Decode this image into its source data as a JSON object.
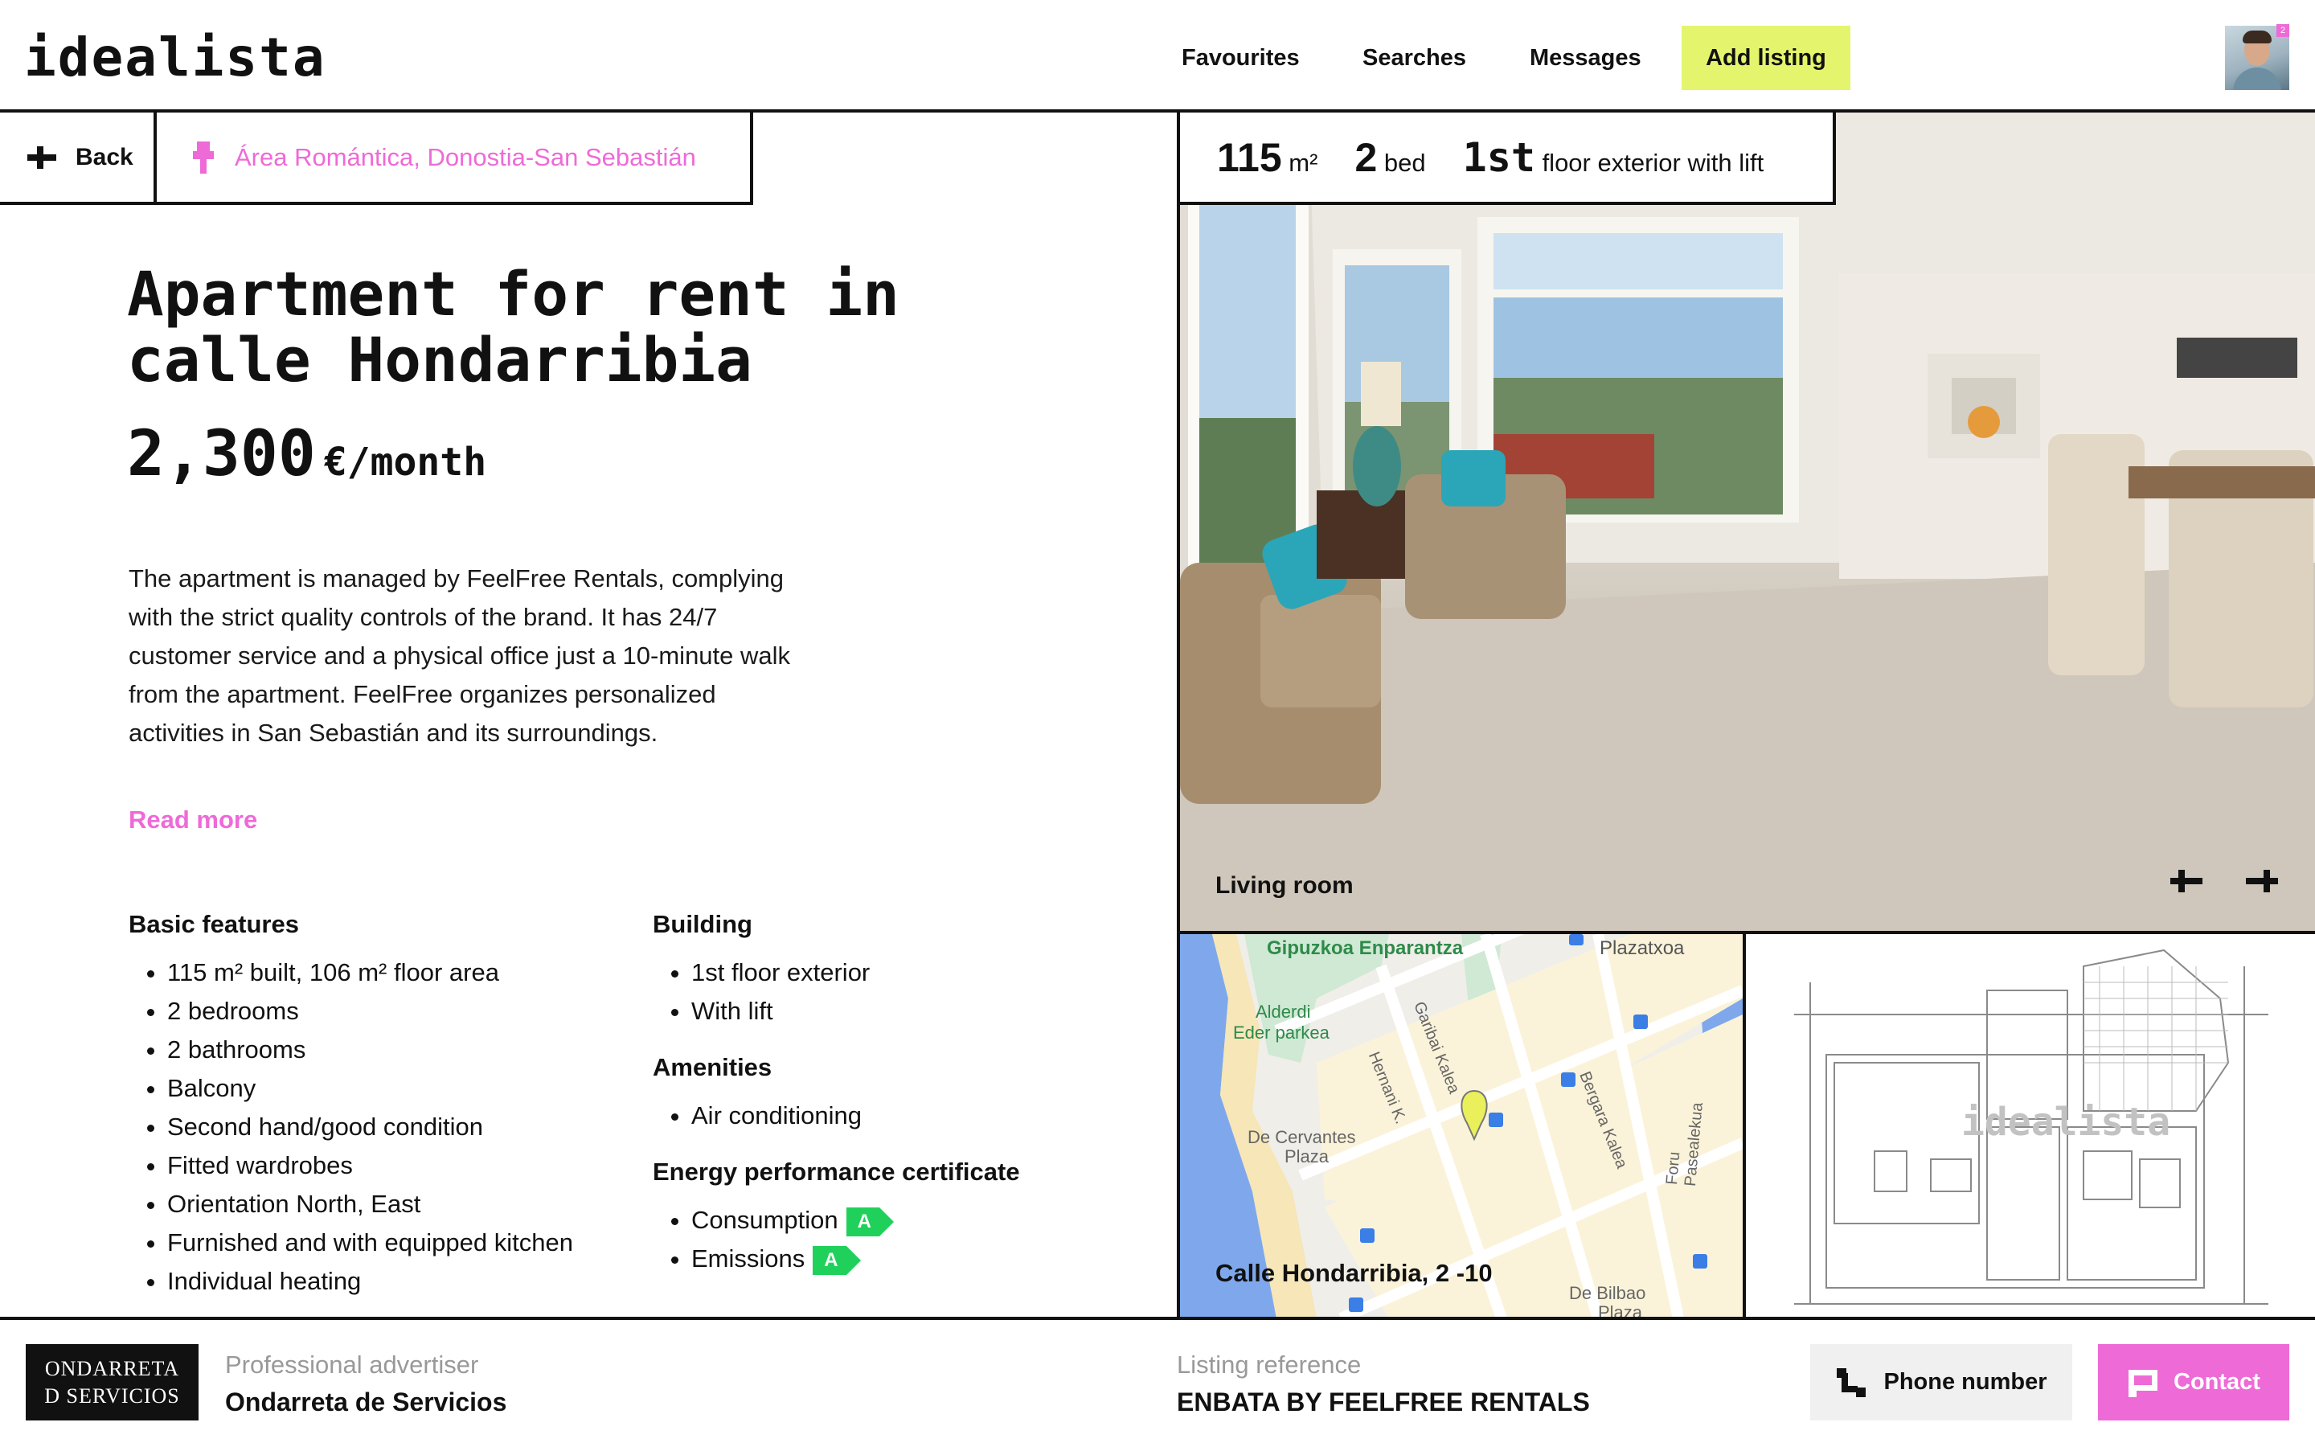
{
  "header": {
    "logo": "idealista",
    "nav": [
      "Favourites",
      "Searches",
      "Messages"
    ],
    "add_listing": "Add listing",
    "notification_count": "2"
  },
  "breadcrumb": {
    "back": "Back",
    "location": "Área Romántica, Donostia-San Sebastián"
  },
  "listing": {
    "title": "Apartment for rent in calle Hondarribia",
    "price": "2,300",
    "price_unit": "€/month",
    "description": "The apartment is managed by FeelFree Rentals, complying with the strict quality controls of the brand. It has 24/7 customer service and a physical office just a 10-minute walk from the apartment. FeelFree organizes personalized activities in San Sebastián and its surroundings.",
    "read_more": "Read more"
  },
  "stats": {
    "area_value": "115",
    "area_unit": "m²",
    "beds_value": "2",
    "beds_unit": "bed",
    "floor_value": "1st",
    "floor_text": "floor exterior with lift"
  },
  "features": {
    "basic_title": "Basic features",
    "basic": [
      "115 m² built, 106 m² floor area",
      "2 bedrooms",
      "2 bathrooms",
      "Balcony",
      "Second hand/good condition",
      "Fitted wardrobes",
      "Orientation North, East",
      "Furnished and with equipped kitchen",
      "Individual heating"
    ],
    "building_title": "Building",
    "building": [
      "1st floor exterior",
      "With lift"
    ],
    "amenities_title": "Amenities",
    "amenities": [
      "Air conditioning"
    ],
    "energy_title": "Energy performance certificate",
    "energy": [
      {
        "label": "Consumption",
        "rating": "A"
      },
      {
        "label": "Emissions",
        "rating": "A"
      }
    ]
  },
  "gallery": {
    "caption": "Living room"
  },
  "map": {
    "caption": "Calle Hondarribia, 2 -10",
    "labels": [
      "Gipuzkoa Enparantza",
      "Plazatxoa",
      "Alderdi",
      "Eder parkea",
      "Garibai Kalea",
      "Hernani K.",
      "Bergara Kalea",
      "Foru Pasealekua",
      "De Cervantes",
      "Plaza",
      "De Bilbao",
      "Plaza"
    ]
  },
  "floorplan": {
    "watermark": "idealista"
  },
  "footer": {
    "advertiser_logo_line1": "ONDARRETA",
    "advertiser_logo_line2": "D SERVICIOS",
    "advertiser_role": "Professional advertiser",
    "advertiser_name": "Ondarreta de Servicios",
    "reference_label": "Listing reference",
    "reference_value": "ENBATA BY FEELFREE RENTALS",
    "phone_button": "Phone number",
    "contact_button": "Contact"
  },
  "colors": {
    "accent_pink": "#ee6ad7",
    "accent_lime": "#e4f56d",
    "energy_green": "#1fd15b"
  }
}
